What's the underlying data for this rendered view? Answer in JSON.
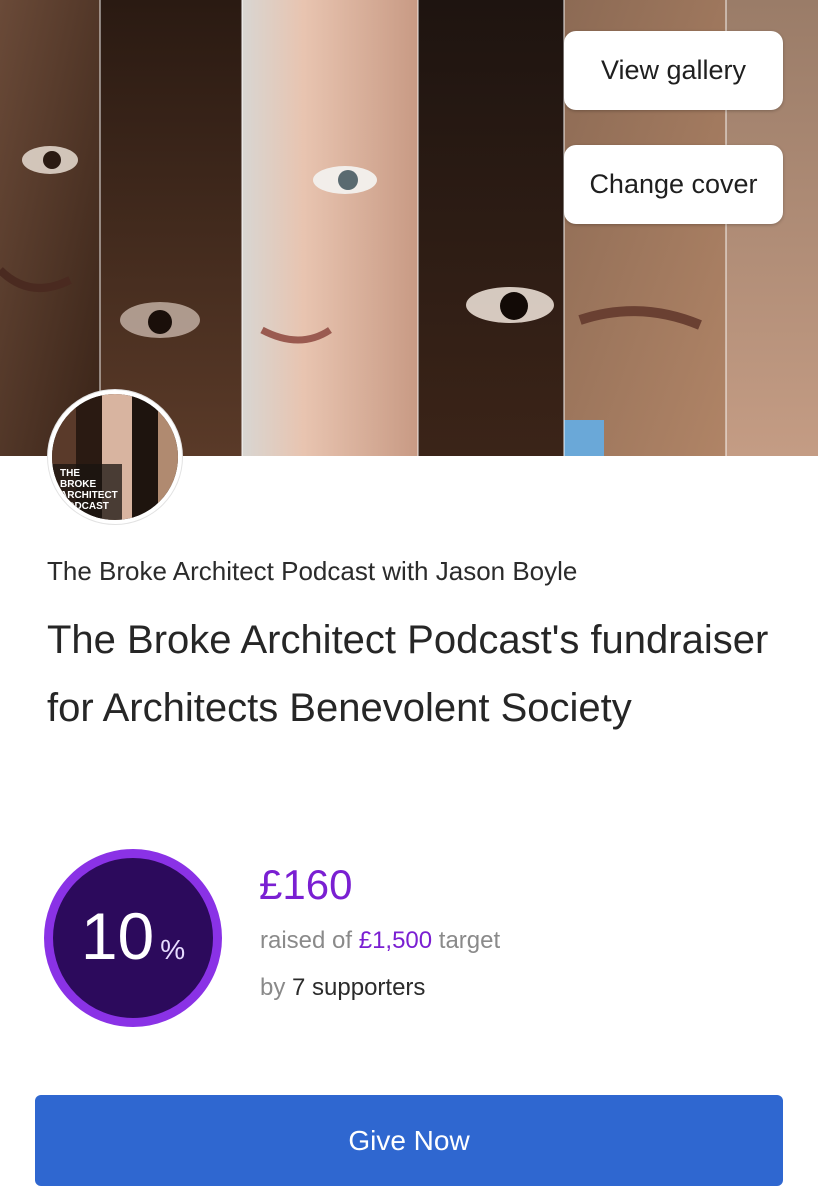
{
  "cover": {
    "view_gallery_label": "View gallery",
    "change_cover_label": "Change cover"
  },
  "avatar": {
    "logo_text_lines": [
      "THE",
      "BROKE",
      "ARCHITECT",
      "PODCAST"
    ]
  },
  "page": {
    "org_name": "The Broke Architect Podcast with Jason Boyle",
    "title": "The Broke Architect Podcast's fundraiser for Architects Benevolent Society"
  },
  "progress": {
    "percent": "10",
    "percent_sign": "%",
    "fraction": 0.1
  },
  "funds": {
    "raised_amount": "£160",
    "raised_prefix": "raised of ",
    "target_amount": "£1,500",
    "target_suffix": " target",
    "by_prefix": "by ",
    "supporters": "7 supporters"
  },
  "actions": {
    "give_label": "Give Now"
  },
  "colors": {
    "accent_purple": "#7a1fd2",
    "ring_fill": "#2c0a5c",
    "ring_border": "#8a32e6",
    "give_button": "#2f67d0"
  }
}
